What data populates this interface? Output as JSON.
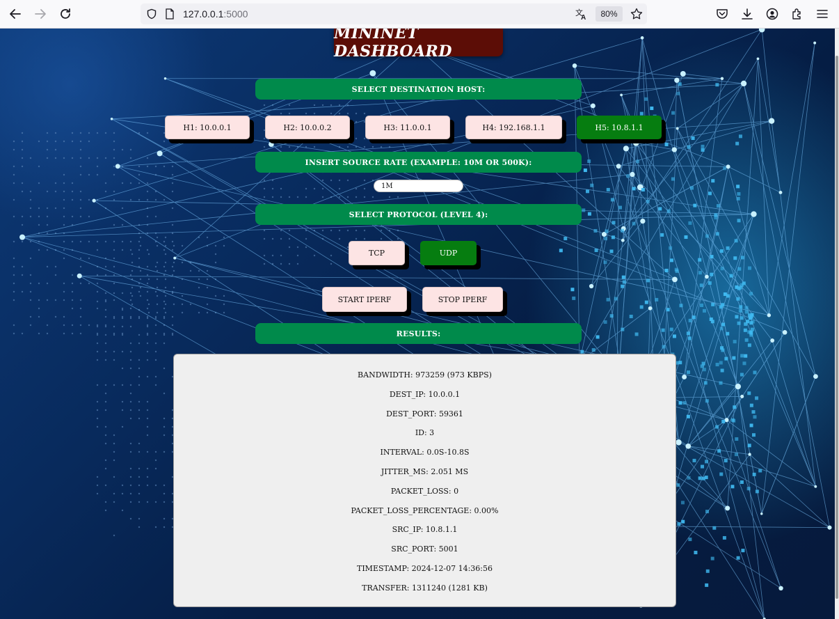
{
  "browser": {
    "url_host": "127.0.0.1",
    "url_port": ":5000",
    "zoom": "80%"
  },
  "dashboard": {
    "title": "MININET DASHBOARD",
    "select_host_label": "SELECT DESTINATION HOST:",
    "hosts": [
      {
        "label": "H1: 10.0.0.1",
        "active": false
      },
      {
        "label": "H2: 10.0.0.2",
        "active": false
      },
      {
        "label": "H3: 11.0.0.1",
        "active": false
      },
      {
        "label": "H4: 192.168.1.1",
        "active": false
      },
      {
        "label": "H5: 10.8.1.1",
        "active": true
      }
    ],
    "rate_label": "INSERT SOURCE RATE (EXAMPLE: 10M OR 500K):",
    "rate_value": "1M",
    "protocol_label": "SELECT PROTOCOL (LEVEL 4):",
    "protocols": [
      {
        "label": "TCP",
        "active": false
      },
      {
        "label": "UDP",
        "active": true
      }
    ],
    "start_label": "START IPERF",
    "stop_label": "STOP IPERF",
    "results_label": "RESULTS:",
    "results": [
      "BANDWIDTH: 973259 (973 KBPS)",
      "DEST_IP: 10.0.0.1",
      "DEST_PORT: 59361",
      "ID: 3",
      "INTERVAL: 0.0S-10.8S",
      "JITTER_MS: 2.051 MS",
      "PACKET_LOSS: 0",
      "PACKET_LOSS_PERCENTAGE: 0.00%",
      "SRC_IP: 10.8.1.1",
      "SRC_PORT: 5001",
      "TIMESTAMP: 2024-12-07 14:36:56",
      "TRANSFER: 1311240 (1281 KB)"
    ]
  },
  "colors": {
    "section_green": "#008a4b",
    "active_green": "#067d10",
    "button_pink": "#fde4e4",
    "title_maroon": "#5c0d06"
  }
}
